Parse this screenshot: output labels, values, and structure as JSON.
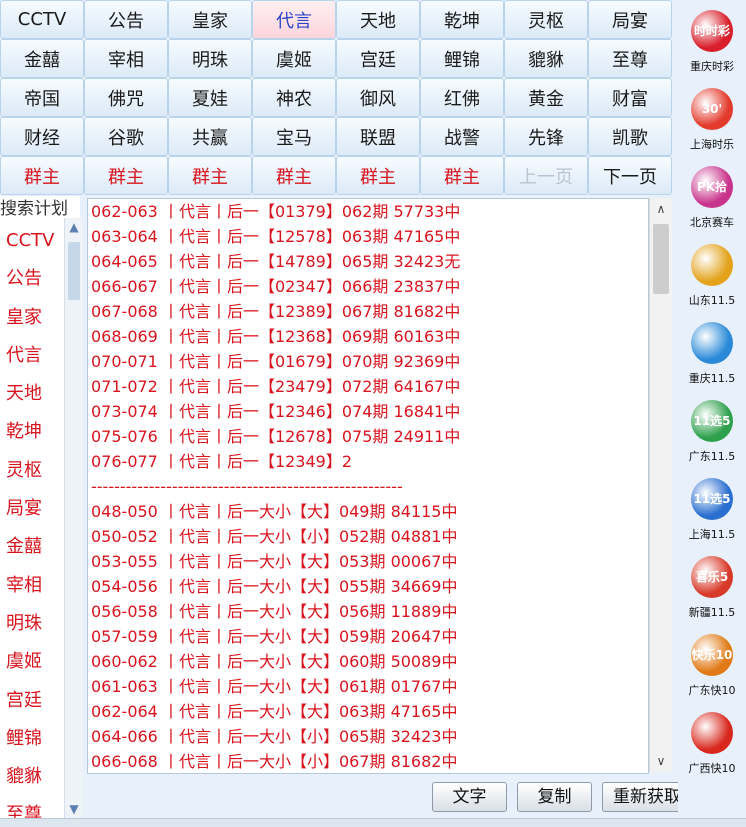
{
  "tabs": [
    [
      "CCTV",
      "公告",
      "皇家",
      "代言",
      "天地",
      "乾坤",
      "灵枢",
      "局宴"
    ],
    [
      "金囍",
      "宰相",
      "明珠",
      "虞姬",
      "宫廷",
      "鲤锦",
      "貔貅",
      "至尊"
    ],
    [
      "帝国",
      "佛咒",
      "夏娃",
      "神农",
      "御风",
      "红佛",
      "黄金",
      "财富"
    ],
    [
      "财经",
      "谷歌",
      "共赢",
      "宝马",
      "联盟",
      "战警",
      "先锋",
      "凯歌"
    ],
    [
      "群主",
      "群主",
      "群主",
      "群主",
      "群主",
      "群主",
      "上一页",
      "下一页"
    ]
  ],
  "search_label": "搜索计划",
  "left_list": [
    "CCTV",
    "公告",
    "皇家",
    "代言",
    "天地",
    "乾坤",
    "灵枢",
    "局宴",
    "金囍",
    "宰相",
    "明珠",
    "虞姬",
    "宫廷",
    "鲤锦",
    "貔貅",
    "至尊"
  ],
  "content_lines": [
    "062-063 丨代言丨后一【01379】062期 57733中",
    "063-064 丨代言丨后一【12578】063期 47165中",
    "064-065 丨代言丨后一【14789】065期 32423无",
    "066-067 丨代言丨后一【02347】066期 23837中",
    "067-068 丨代言丨后一【12389】067期 81682中",
    "068-069 丨代言丨后一【12368】069期 60163中",
    "070-071 丨代言丨后一【01679】070期 92369中",
    "071-072 丨代言丨后一【23479】072期 64167中",
    "073-074 丨代言丨后一【12346】074期 16841中",
    "075-076 丨代言丨后一【12678】075期 24911中",
    "076-077 丨代言丨后一【12349】2",
    "------------------------------------------------------",
    "048-050 丨代言丨后一大小【大】049期 84115中",
    "050-052 丨代言丨后一大小【小】052期 04881中",
    "053-055 丨代言丨后一大小【大】053期 00067中",
    "054-056 丨代言丨后一大小【大】055期 34669中",
    "056-058 丨代言丨后一大小【大】056期 11889中",
    "057-059 丨代言丨后一大小【大】059期 20647中",
    "060-062 丨代言丨后一大小【大】060期 50089中",
    "061-063 丨代言丨后一大小【大】061期 01767中",
    "062-064 丨代言丨后一大小【大】063期 47165中",
    "064-066 丨代言丨后一大小【小】065期 32423中",
    "066-068 丨代言丨后一大小【小】067期 81682中"
  ],
  "buttons": {
    "text": "文字",
    "copy": "复制",
    "refresh": "重新获取"
  },
  "sidebar": [
    {
      "label": "重庆时彩",
      "logo_text": "时时彩",
      "color": "#d81e2a"
    },
    {
      "label": "上海时乐",
      "logo_text": "30'",
      "color": "#e23b2c"
    },
    {
      "label": "北京赛车",
      "logo_text": "PK拾",
      "color": "#c8348c"
    },
    {
      "label": "山东11.5",
      "logo_text": "",
      "color": "#e3a21a"
    },
    {
      "label": "重庆11.5",
      "logo_text": "",
      "color": "#2a8ad8"
    },
    {
      "label": "广东11.5",
      "logo_text": "11选5",
      "color": "#2ea04c"
    },
    {
      "label": "上海11.5",
      "logo_text": "11选5",
      "color": "#2a6fd0"
    },
    {
      "label": "新疆11.5",
      "logo_text": "喜乐5",
      "color": "#d83a2a"
    },
    {
      "label": "广东快10",
      "logo_text": "快乐10",
      "color": "#e07a16"
    },
    {
      "label": "广西快10",
      "logo_text": "",
      "color": "#d8281e"
    }
  ],
  "colors": {
    "accent_red": "#d8141e",
    "active_tab_text": "#2a44c8",
    "panel_bg": "#e8f1fb"
  }
}
